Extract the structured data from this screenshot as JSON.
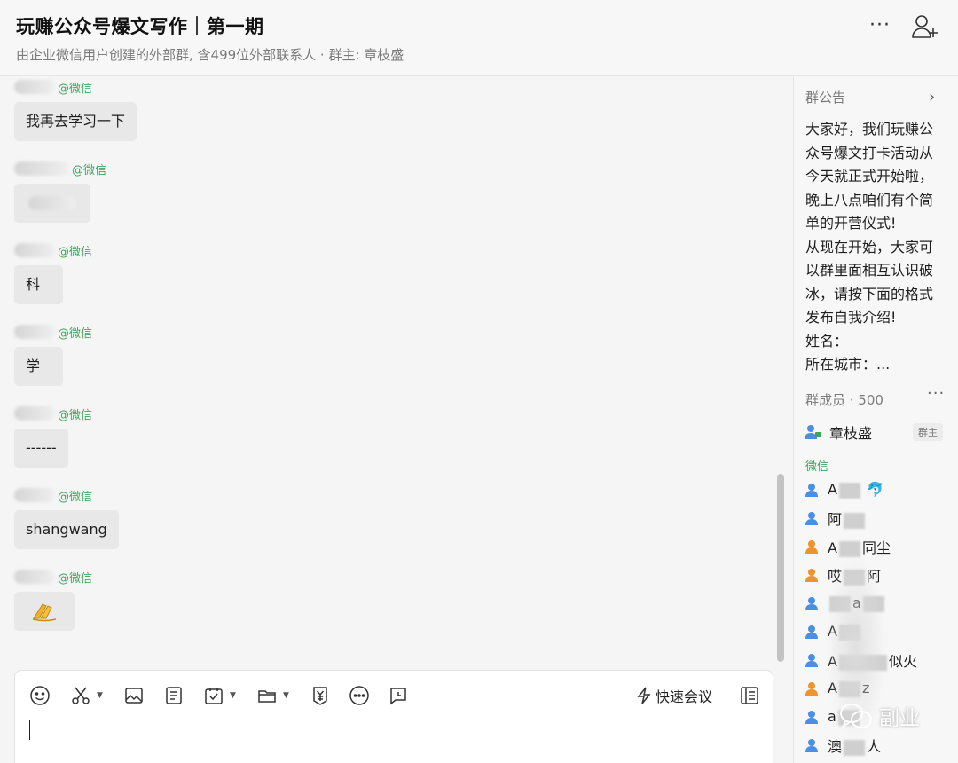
{
  "header": {
    "title": "玩赚公众号爆文写作｜第一期",
    "subtitle": "由企业微信用户创建的外部群, 含499位外部联系人 · 群主: 章枝盛",
    "more_label": "···"
  },
  "messages": [
    {
      "source": "@微信",
      "text": "我再去学习一下"
    },
    {
      "source": "@微信",
      "text": ""
    },
    {
      "source": "@微信",
      "text": "科"
    },
    {
      "source": "@微信",
      "text": "学"
    },
    {
      "source": "@微信",
      "text": "------"
    },
    {
      "source": "@微信",
      "text": "shangwang"
    },
    {
      "source": "@微信",
      "text": ""
    }
  ],
  "composer": {
    "tools": [
      "emoji-icon",
      "scissors-icon",
      "image-icon",
      "document-icon",
      "schedule-icon",
      "folder-icon",
      "red-packet-icon",
      "more-icon",
      "chat-record-icon"
    ],
    "quick_meeting": "快速会议"
  },
  "sidebar": {
    "notice_title": "群公告",
    "notice_lines": [
      "大家好，我们玩赚公",
      "众号爆文打卡活动从",
      "今天就正式开始啦，",
      "晚上八点咱们有个简",
      "单的开营仪式!",
      "从现在开始，大家可",
      "以群里面相互认识破",
      "冰，请按下面的格式",
      "发布自我介绍!",
      "姓名：",
      "所在城市：..."
    ],
    "members_title": "群成员 · 500",
    "members_more": "···",
    "owner": {
      "name": "章枝盛",
      "badge": "群主"
    },
    "wechat_label": "微信",
    "members": [
      {
        "prefix": "A",
        "suffix": "",
        "color": "#4a8ee6",
        "emoji": "🐬"
      },
      {
        "prefix": "阿",
        "suffix": "",
        "color": "#4a8ee6"
      },
      {
        "prefix": "A",
        "suffix": "同尘",
        "color": "#f0932b"
      },
      {
        "prefix": "哎",
        "suffix": "阿",
        "color": "#f0932b"
      },
      {
        "prefix": "",
        "suffix": "a",
        "color": "#4a8ee6"
      },
      {
        "prefix": "A",
        "suffix": "",
        "color": "#4a8ee6"
      },
      {
        "prefix": "A",
        "suffix": "似火",
        "color": "#4a8ee6"
      },
      {
        "prefix": "A",
        "suffix": "z",
        "color": "#f0932b"
      },
      {
        "prefix": "a",
        "suffix": "",
        "color": "#4a8ee6"
      },
      {
        "prefix": "澳",
        "suffix": "人",
        "color": "#4a8ee6"
      }
    ]
  },
  "watermark": "副业",
  "colors": {
    "wechat_green": "#3fa55b",
    "member_blue": "#4a8ee6",
    "member_orange": "#f0932b",
    "bubble": "#e8e8e8"
  }
}
